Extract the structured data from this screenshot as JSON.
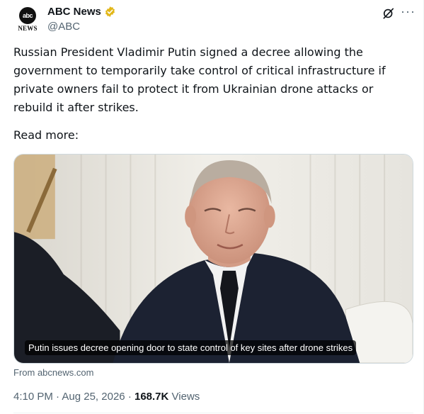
{
  "account": {
    "logo_text": "abc",
    "logo_sub": "NEWS",
    "display_name": "ABC News",
    "handle": "@ABC"
  },
  "post": {
    "text": "Russian President Vladimir Putin signed a decree allowing the government to temporarily take control of critical infrastructure if private owners fail to protect it from Ukrainian drone attacks or rebuild it after strikes.",
    "read_more": "Read more:"
  },
  "card": {
    "caption": "Putin issues decree opening door to state control of key sites after drone strikes",
    "source": "From abcnews.com"
  },
  "meta": {
    "time": "4:10 PM",
    "separator": "·",
    "date": "Aug 25, 2026",
    "views_count": "168.7K",
    "views_label": "Views"
  },
  "icons": {
    "verified": "verified-badge-icon",
    "grok": "grok-icon",
    "more": "more-icon"
  },
  "colors": {
    "verified_gold": "#e2b719",
    "muted_text": "#536471",
    "text": "#0f1419"
  }
}
